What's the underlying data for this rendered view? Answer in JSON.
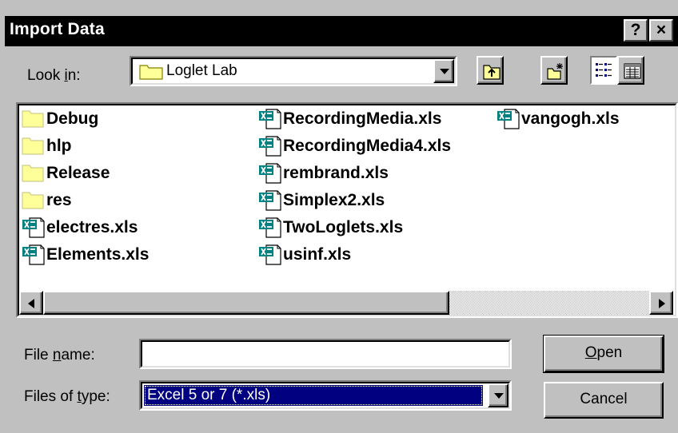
{
  "window": {
    "title": "Import Data",
    "help_button": "?",
    "close_button": "×"
  },
  "look_in": {
    "label_pre": "Look ",
    "label_accel": "i",
    "label_post": "n:",
    "value": "Loglet Lab"
  },
  "toolbar": {
    "up_folder": "up-folder-icon",
    "new_folder": "new-folder-icon",
    "list_view": "list-view-icon",
    "details_view": "details-view-icon"
  },
  "files": [
    {
      "name": "Debug",
      "kind": "folder"
    },
    {
      "name": "hlp",
      "kind": "folder"
    },
    {
      "name": "Release",
      "kind": "folder"
    },
    {
      "name": "res",
      "kind": "folder"
    },
    {
      "name": "electres.xls",
      "kind": "xls"
    },
    {
      "name": "Elements.xls",
      "kind": "xls"
    },
    {
      "name": "RecordingMedia.xls",
      "kind": "xls"
    },
    {
      "name": "RecordingMedia4.xls",
      "kind": "xls"
    },
    {
      "name": "rembrand.xls",
      "kind": "xls"
    },
    {
      "name": "Simplex2.xls",
      "kind": "xls"
    },
    {
      "name": "TwoLoglets.xls",
      "kind": "xls"
    },
    {
      "name": "usinf.xls",
      "kind": "xls"
    },
    {
      "name": "vangogh.xls",
      "kind": "xls"
    }
  ],
  "file_name": {
    "label_pre": "File ",
    "label_accel": "n",
    "label_post": "ame:",
    "value": ""
  },
  "files_of_type": {
    "label_pre": "Files of ",
    "label_accel": "t",
    "label_post": "ype:",
    "value": "Excel 5 or 7 (*.xls)"
  },
  "buttons": {
    "open_accel": "O",
    "open_rest": "pen",
    "cancel": "Cancel"
  },
  "colors": {
    "title_bg": "#000000",
    "face": "#c0c0c0",
    "folder": "#ffff99",
    "selection": "#000080"
  }
}
